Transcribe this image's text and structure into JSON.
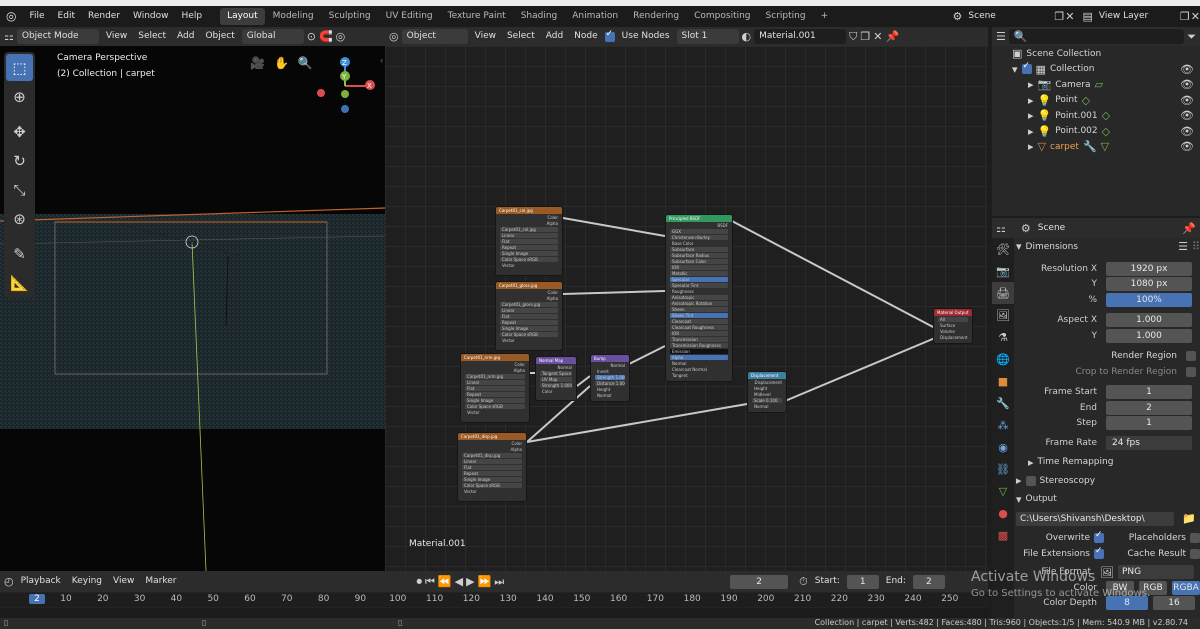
{
  "menubar": {
    "items": [
      "File",
      "Edit",
      "Render",
      "Window",
      "Help"
    ],
    "workspaces": [
      "Layout",
      "Modeling",
      "Sculpting",
      "UV Editing",
      "Texture Paint",
      "Shading",
      "Animation",
      "Rendering",
      "Compositing",
      "Scripting"
    ],
    "add_tab": "+",
    "scene": "Scene",
    "view_layer": "View Layer"
  },
  "viewport": {
    "mode": "Object Mode",
    "menus": [
      "View",
      "Select",
      "Add",
      "Object"
    ],
    "orientation": "Global",
    "title": "Camera Perspective",
    "subtitle": "(2) Collection | carpet",
    "gizmo": {
      "z": "Z",
      "y": "Y",
      "x": "X"
    }
  },
  "nodes_header": {
    "type": "Object",
    "menus": [
      "View",
      "Select",
      "Add",
      "Node"
    ],
    "use_nodes": "Use Nodes",
    "slot": "Slot 1",
    "material": "Material.001"
  },
  "node_editor": {
    "label": "Material.001",
    "nodes": {
      "img1": {
        "title": "Carpet01_col.jpg",
        "rows": [
          "Color",
          "Alpha",
          "Carpet01_col.jpg",
          "Linear",
          "Flat",
          "Repeat",
          "Single Image",
          "Color Space sRGB",
          "Vector"
        ]
      },
      "img2": {
        "title": "Carpet01_gloss.jpg",
        "rows": [
          "Color",
          "Alpha",
          "Carpet01_gloss.jpg",
          "Linear",
          "Flat",
          "Repeat",
          "Single Image",
          "Color Space sRGB",
          "Vector"
        ]
      },
      "img3": {
        "title": "Carpet01_nrm.jpg",
        "rows": [
          "Color",
          "Alpha",
          "Carpet01_nrm.jpg",
          "Linear",
          "Flat",
          "Repeat",
          "Single Image",
          "Color Space sRGB",
          "Vector"
        ]
      },
      "img4": {
        "title": "Carpet01_disp.jpg",
        "rows": [
          "Color",
          "Alpha",
          "Carpet01_disp.jpg",
          "Linear",
          "Flat",
          "Repeat",
          "Single Image",
          "Color Space sRGB",
          "Vector"
        ]
      },
      "normalmap": {
        "title": "Normal Map",
        "rows": [
          "Normal",
          "Tangent Space",
          "UV Map",
          "Strength 1.000",
          "Color"
        ]
      },
      "bump": {
        "title": "Bump",
        "rows": [
          "Normal",
          "Invert",
          "Strength 1.000",
          "Distance 1.000",
          "Height",
          "Normal"
        ]
      },
      "bsdf": {
        "title": "Principled BSDF",
        "rows": [
          "BSDF",
          "GGX",
          "Christensen-Burley",
          "Base Color",
          "Subsurface",
          "Subsurface Radius",
          "Subsurface Color",
          "IOR",
          "Metallic",
          "Specular",
          "Specular Tint",
          "Roughness",
          "Anisotropic",
          "Anisotropic Rotation",
          "Sheen",
          "Sheen Tint",
          "Clearcoat",
          "Clearcoat Roughness",
          "IOR",
          "Transmission",
          "Transmission Roughness",
          "Emission",
          "Alpha",
          "Normal",
          "Clearcoat Normal",
          "Tangent"
        ]
      },
      "displacement": {
        "title": "Displacement",
        "rows": [
          "Displacement",
          "Height",
          "Midlevel",
          "Scale 0.100",
          "Normal"
        ]
      },
      "output": {
        "title": "Material Output",
        "rows": [
          "All",
          "Surface",
          "Volume",
          "Displacement"
        ]
      }
    }
  },
  "outliner": {
    "root": "Scene Collection",
    "items": [
      {
        "label": "Collection",
        "icon": "collection-icon",
        "active": false
      },
      {
        "label": "Camera",
        "icon": "camera-icon",
        "active": false
      },
      {
        "label": "Point",
        "icon": "light-icon",
        "active": false
      },
      {
        "label": "Point.001",
        "icon": "light-icon",
        "active": false
      },
      {
        "label": "Point.002",
        "icon": "light-icon",
        "active": false
      },
      {
        "label": "carpet",
        "icon": "mesh-icon",
        "active": true
      }
    ]
  },
  "properties": {
    "context": "Scene",
    "dimensions": "Dimensions",
    "res_x_label": "Resolution X",
    "res_x": "1920 px",
    "res_y_label": "Y",
    "res_y": "1080 px",
    "pct_label": "%",
    "pct": "100%",
    "aspect_x_label": "Aspect X",
    "aspect_x": "1.000",
    "aspect_y_label": "Y",
    "aspect_y": "1.000",
    "render_region": "Render Region",
    "crop": "Crop to Render Region",
    "frame_start_label": "Frame Start",
    "frame_start": "1",
    "end_label": "End",
    "end": "2",
    "step_label": "Step",
    "step": "1",
    "frame_rate_label": "Frame Rate",
    "frame_rate": "24 fps",
    "time_remap": "Time Remapping",
    "stereo": "Stereoscopy",
    "output": "Output",
    "path": "C:\\Users\\Shivansh\\Desktop\\",
    "overwrite": "Overwrite",
    "placeholders": "Placeholders",
    "file_ext": "File Extensions",
    "cache": "Cache Result",
    "file_format_label": "File Format",
    "file_format": "PNG",
    "color_label": "Color",
    "bw": "BW",
    "rgb": "RGB",
    "rgba": "RGBA",
    "color_depth_label": "Color Depth",
    "depth8": "8",
    "depth16": "16"
  },
  "timeline": {
    "menus": [
      "Playback",
      "Keying",
      "View",
      "Marker"
    ],
    "current": "2",
    "start_label": "Start:",
    "start": "1",
    "end_label": "End:",
    "end": "2",
    "ticks": [
      "2",
      "10",
      "20",
      "30",
      "40",
      "50",
      "60",
      "70",
      "80",
      "90",
      "100",
      "110",
      "120",
      "130",
      "140",
      "150",
      "160",
      "170",
      "180",
      "190",
      "200",
      "210",
      "220",
      "230",
      "240",
      "250"
    ]
  },
  "status": "Collection | carpet | Verts:482 | Faces:480 | Tris:960 | Objects:1/5 | Mem: 540.9 MB | v2.80.74",
  "watermark": {
    "line1": "Activate Windows",
    "line2": "Go to Settings to activate Windows."
  }
}
